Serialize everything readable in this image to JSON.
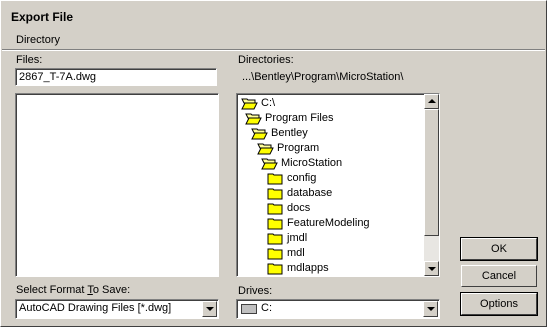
{
  "window": {
    "title": "Export File"
  },
  "menu": {
    "directory": "Directory"
  },
  "files": {
    "label": "Files:",
    "value": "2867_T-7A.dwg"
  },
  "directories": {
    "label": "Directories:",
    "path": "...\\Bentley\\Program\\MicroStation\\",
    "tree": [
      {
        "name": "C:\\",
        "open": true
      },
      {
        "name": "Program Files",
        "open": true
      },
      {
        "name": "Bentley",
        "open": true
      },
      {
        "name": "Program",
        "open": true
      },
      {
        "name": "MicroStation",
        "open": true
      },
      {
        "name": "config",
        "open": false
      },
      {
        "name": "database",
        "open": false
      },
      {
        "name": "docs",
        "open": false
      },
      {
        "name": "FeatureModeling",
        "open": false
      },
      {
        "name": "jmdl",
        "open": false
      },
      {
        "name": "mdl",
        "open": false
      },
      {
        "name": "mdlapps",
        "open": false
      }
    ]
  },
  "format": {
    "label": "Select Format To Save:",
    "value": "AutoCAD Drawing Files [*.dwg]"
  },
  "drives": {
    "label": "Drives:",
    "value": "C:"
  },
  "buttons": {
    "ok": "OK",
    "cancel": "Cancel",
    "options": "Options"
  }
}
